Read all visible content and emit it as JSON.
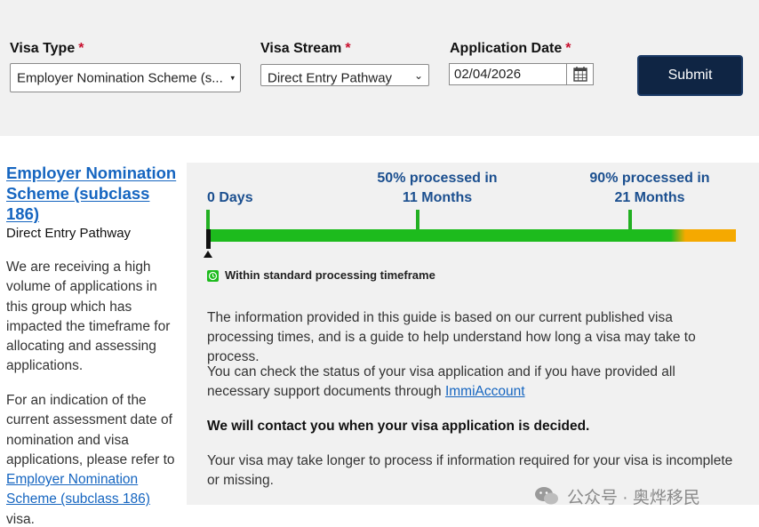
{
  "form": {
    "visa_type": {
      "label": "Visa Type",
      "required": "*",
      "value": "Employer Nomination Scheme (s..."
    },
    "visa_stream": {
      "label": "Visa Stream",
      "required": "*",
      "value": "Direct Entry Pathway"
    },
    "application_date": {
      "label": "Application Date",
      "required": "*",
      "value": "02/04/2026"
    },
    "submit_label": "Submit"
  },
  "left": {
    "title": "Employer Nomination Scheme (subclass 186)",
    "subtitle": "Direct Entry Pathway",
    "para1": "We are receiving a high volume of applications in this group which has impacted the timeframe for allocating and assessing applications.",
    "para2_prefix": "For an indication of the current assessment date of nomination and visa applications, please refer to",
    "para2_link": "Employer Nomination Scheme (subclass 186)",
    "para2_suffix": "visa."
  },
  "timeline": {
    "start_label": "0 Days",
    "mid_label_line1": "50% processed in",
    "mid_label_line2": "11 Months",
    "end_label_line1": "90% processed in",
    "end_label_line2": "21 Months",
    "legend": "Within standard processing timeframe",
    "colors": {
      "within": "#1dbb1d",
      "beyond": "#f5a900"
    }
  },
  "info": {
    "p1": "The information provided in this guide is based on our current published visa processing times, and is a guide to help understand how long a visa may take to process.",
    "p2_prefix": "You can check the status of your visa application and if you have provided all necessary support documents through",
    "p2_link": "ImmiAccount",
    "p3": "We will contact you when your visa application is decided.",
    "p4": "Your visa may take longer to process if information required for your visa is incomplete or missing."
  },
  "watermark": "公众号 · 奥烨移民"
}
